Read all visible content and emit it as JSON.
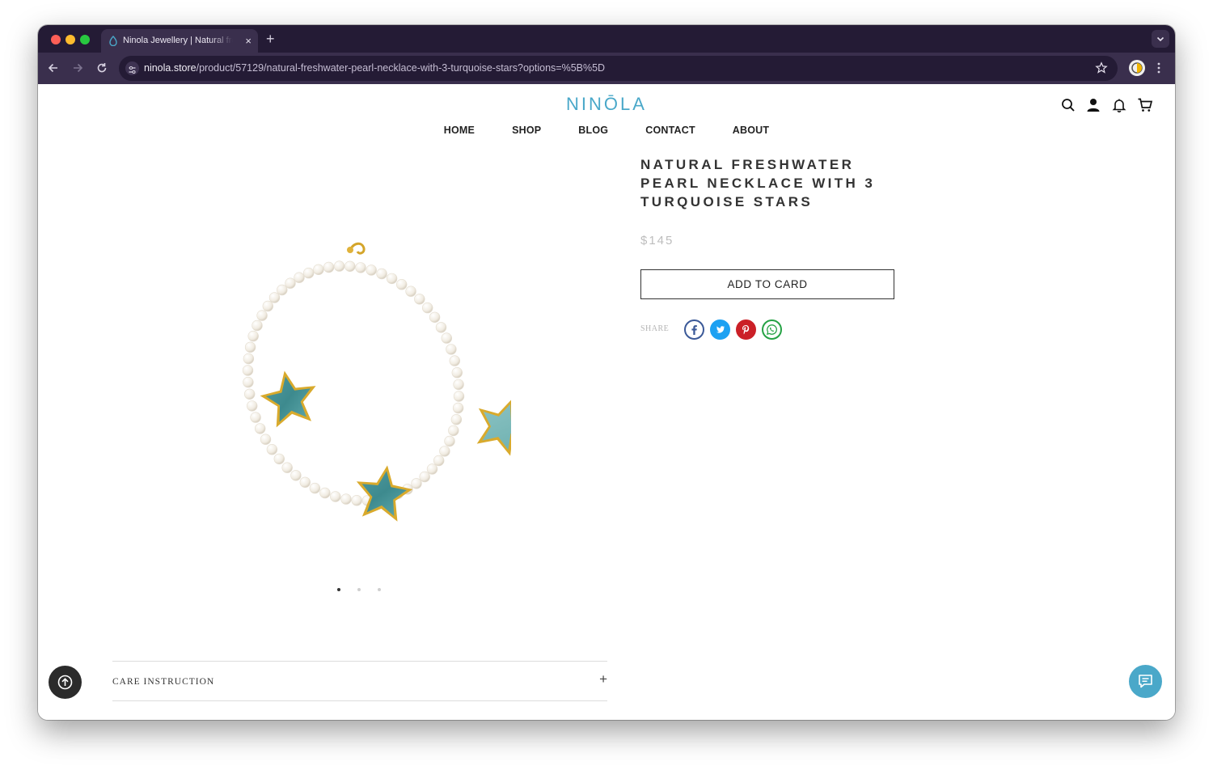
{
  "browser": {
    "tab_title": "Ninola Jewellery | Natural freshwater",
    "new_tab_label": "+",
    "tab_close_label": "×",
    "url_host": "ninola.store",
    "url_path": "/product/57129/natural-freshwater-pearl-necklace-with-3-turquoise-stars?options=%5B%5D"
  },
  "site": {
    "logo": "NINŌLA",
    "nav": [
      "HOME",
      "SHOP",
      "BLOG",
      "CONTACT",
      "ABOUT"
    ],
    "header_icons": [
      "search-icon",
      "user-icon",
      "bell-icon",
      "cart-icon"
    ]
  },
  "product": {
    "title": "NATURAL FRESHWATER PEARL NECKLACE WITH 3 TURQUOISE STARS",
    "price": "$145",
    "add_button": "ADD TO CARD",
    "share_label": "SHARE",
    "share_targets": [
      "facebook-icon",
      "twitter-icon",
      "pinterest-icon",
      "whatsapp-icon"
    ],
    "gallery_count": 3,
    "gallery_active_index": 0
  },
  "accordion": {
    "care_label": "CARE INSTRUCTION",
    "care_toggle": "+"
  },
  "colors": {
    "brand": "#4aa8c9",
    "browser_frame": "#241b35",
    "facebook": "#3b5998",
    "twitter": "#1da1f2",
    "pinterest": "#cb2027",
    "whatsapp": "#25a244"
  }
}
